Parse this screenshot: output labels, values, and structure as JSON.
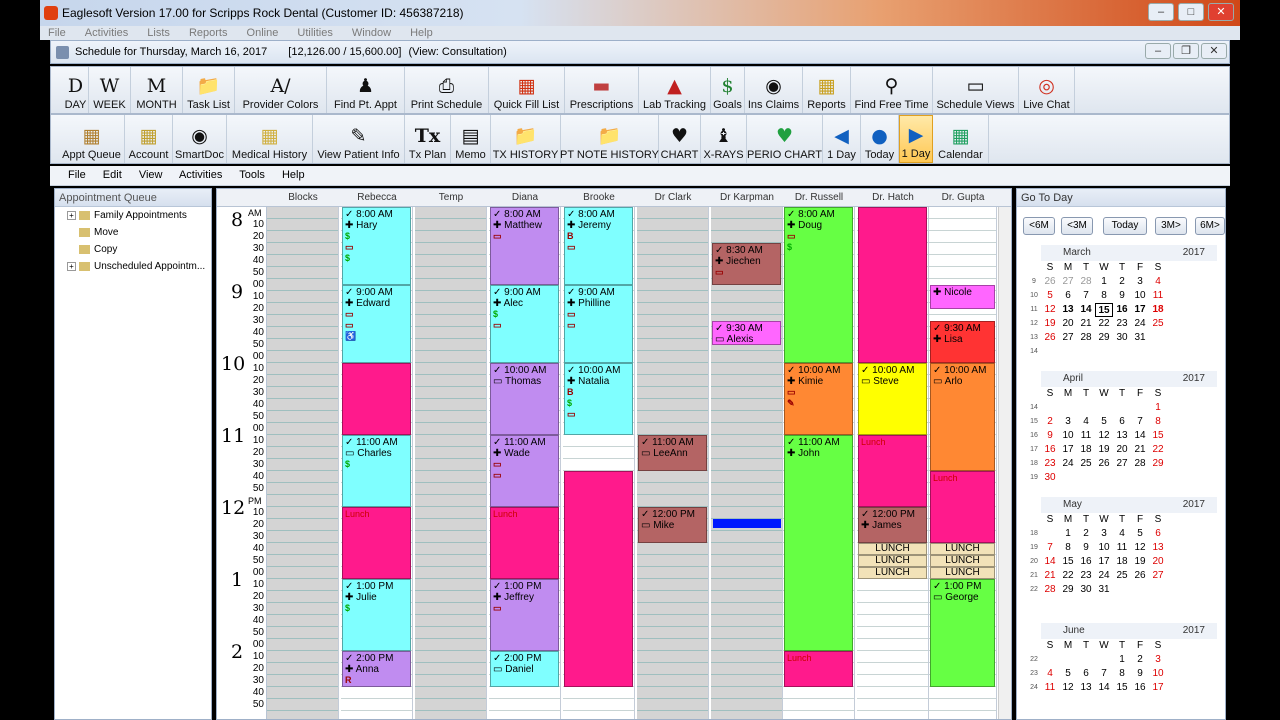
{
  "window": {
    "title": "Eaglesoft Version 17.00 for Scripps Rock Dental (Customer ID: 456387218)"
  },
  "outer_menu": [
    "File",
    "Activities",
    "Lists",
    "Reports",
    "Online",
    "Utilities",
    "Window",
    "Help"
  ],
  "schedule": {
    "title": "Schedule for Thursday, March 16, 2017",
    "totals": "[12,126.00 / 15,600.00]",
    "view": "(View: Consultation)"
  },
  "toolbar1": [
    "DAY",
    "WEEK",
    "MONTH",
    "Task List",
    "Provider Colors",
    "Find Pt. Appt",
    "Print Schedule",
    "Quick Fill List",
    "Prescriptions",
    "Lab Tracking",
    "Goals",
    "Ins Claims",
    "Reports",
    "Find Free Time",
    "Schedule Views",
    "Live Chat"
  ],
  "toolbar2": [
    "Appt Queue",
    "Account",
    "SmartDoc",
    "Medical History",
    "View Patient Info",
    "Tx Plan",
    "Memo",
    "TX HISTORY",
    "PT NOTE HISTORY",
    "CHART",
    "X-RAYS",
    "PERIO CHART",
    "1 Day",
    "Today",
    "1 Day",
    "Calendar"
  ],
  "inner_menu": [
    "File",
    "Edit",
    "View",
    "Activities",
    "Tools",
    "Help"
  ],
  "queue": {
    "title": "Appointment Queue",
    "items": [
      "Family Appointments",
      "Move",
      "Copy",
      "Unscheduled Appointm..."
    ]
  },
  "providers": [
    "Blocks",
    "Rebecca",
    "Temp",
    "Diana",
    "Brooke",
    "Dr Clark",
    "Dr Karpman",
    "Dr. Russell",
    "Dr. Hatch",
    "Dr. Gupta"
  ],
  "hours": [
    {
      "hour": "8",
      "ampm": "AM"
    },
    {
      "hour": "9",
      "ampm": ""
    },
    {
      "hour": "10",
      "ampm": ""
    },
    {
      "hour": "11",
      "ampm": ""
    },
    {
      "hour": "12",
      "ampm": "PM"
    },
    {
      "hour": "1",
      "ampm": ""
    },
    {
      "hour": "2",
      "ampm": ""
    }
  ],
  "minute_labels": [
    "00",
    "10",
    "20",
    "30",
    "40",
    "50"
  ],
  "appointments": [
    {
      "provider": 1,
      "start": 0,
      "slots": 13,
      "color": "cyan",
      "time": "8:00 AM",
      "name": "Hary",
      "icons": [
        "+",
        "$",
        "▭",
        "$"
      ]
    },
    {
      "provider": 1,
      "start": 13,
      "slots": 13,
      "color": "cyan",
      "time": "9:00 AM",
      "name": "Edward",
      "icons": [
        "+",
        "▭",
        "▭",
        "♿"
      ]
    },
    {
      "provider": 1,
      "start": 26,
      "slots": 12,
      "color": "pink",
      "time": "",
      "name": "",
      "icons": []
    },
    {
      "provider": 1,
      "start": 38,
      "slots": 12,
      "color": "cyan",
      "time": "11:00 AM",
      "name": "Charles",
      "icons": [
        "▭",
        "$"
      ]
    },
    {
      "provider": 1,
      "start": 50,
      "slots": 12,
      "color": "pink",
      "time": "",
      "name": "",
      "label": "Lunch",
      "icons": []
    },
    {
      "provider": 1,
      "start": 62,
      "slots": 12,
      "color": "cyan",
      "time": "1:00 PM",
      "name": "Julie",
      "icons": [
        "+",
        "$"
      ]
    },
    {
      "provider": 1,
      "start": 74,
      "slots": 6,
      "color": "lav",
      "time": "2:00 PM",
      "name": "Anna",
      "icons": [
        "+",
        "R",
        "▭"
      ]
    },
    {
      "provider": 3,
      "start": 0,
      "slots": 13,
      "color": "lav",
      "time": "8:00 AM",
      "name": "Matthew",
      "icons": [
        "+",
        "▭"
      ]
    },
    {
      "provider": 3,
      "start": 13,
      "slots": 13,
      "color": "cyan",
      "time": "9:00 AM",
      "name": "Alec",
      "icons": [
        "+",
        "$",
        "▭"
      ]
    },
    {
      "provider": 3,
      "start": 26,
      "slots": 12,
      "color": "lav",
      "time": "10:00 AM",
      "name": "Thomas",
      "icons": [
        "▭"
      ]
    },
    {
      "provider": 3,
      "start": 38,
      "slots": 12,
      "color": "lav",
      "time": "11:00 AM",
      "name": "Wade",
      "icons": [
        "+",
        "▭",
        "▭"
      ]
    },
    {
      "provider": 3,
      "start": 50,
      "slots": 12,
      "color": "pink",
      "time": "",
      "name": "",
      "label": "Lunch",
      "icons": []
    },
    {
      "provider": 3,
      "start": 62,
      "slots": 12,
      "color": "lav",
      "time": "1:00 PM",
      "name": "Jeffrey",
      "icons": [
        "+",
        "▭"
      ]
    },
    {
      "provider": 3,
      "start": 74,
      "slots": 6,
      "color": "cyan",
      "time": "2:00 PM",
      "name": "Daniel",
      "icons": [
        "▭"
      ]
    },
    {
      "provider": 4,
      "start": 0,
      "slots": 13,
      "color": "cyan",
      "time": "8:00 AM",
      "name": "Jeremy",
      "icons": [
        "+",
        "B",
        "▭"
      ]
    },
    {
      "provider": 4,
      "start": 13,
      "slots": 13,
      "color": "cyan",
      "time": "9:00 AM",
      "name": "Philline",
      "icons": [
        "+",
        "▭",
        "▭"
      ]
    },
    {
      "provider": 4,
      "start": 26,
      "slots": 12,
      "color": "cyan",
      "time": "10:00 AM",
      "name": "Natalia",
      "icons": [
        "+",
        "B",
        "$",
        "▭"
      ]
    },
    {
      "provider": 4,
      "start": 44,
      "slots": 36,
      "color": "pink",
      "time": "",
      "name": "",
      "icons": []
    },
    {
      "provider": 5,
      "start": 38,
      "slots": 6,
      "color": "brown",
      "time": "11:00 AM",
      "name": "LeeAnn",
      "icons": [
        "$"
      ]
    },
    {
      "provider": 5,
      "start": 50,
      "slots": 6,
      "color": "brown",
      "time": "12:00 PM",
      "name": "Mike",
      "icons": [
        "▭"
      ]
    },
    {
      "provider": 6,
      "start": 6,
      "slots": 7,
      "color": "brown",
      "time": "8:30 AM",
      "name": "Jiechen",
      "icons": [
        "+",
        "▭"
      ]
    },
    {
      "provider": 6,
      "start": 19,
      "slots": 4,
      "color": "magenta",
      "time": "9:30 AM",
      "name": "Alexis",
      "icons": [
        "▭"
      ]
    },
    {
      "provider": 7,
      "start": 0,
      "slots": 26,
      "color": "green",
      "time": "8:00 AM",
      "name": "Doug",
      "icons": [
        "+",
        "▭",
        "$"
      ]
    },
    {
      "provider": 7,
      "start": 26,
      "slots": 12,
      "color": "orange",
      "time": "10:00 AM",
      "name": "Kimie",
      "icons": [
        "+",
        "▭",
        "✎"
      ]
    },
    {
      "provider": 7,
      "start": 38,
      "slots": 36,
      "color": "green",
      "time": "11:00 AM",
      "name": "John",
      "icons": [
        "+"
      ]
    },
    {
      "provider": 7,
      "start": 74,
      "slots": 6,
      "color": "pink",
      "time": "",
      "name": "",
      "label": "Lunch",
      "icons": []
    },
    {
      "provider": 8,
      "start": 0,
      "slots": 26,
      "color": "pink",
      "time": "",
      "name": "",
      "icons": []
    },
    {
      "provider": 8,
      "start": 26,
      "slots": 12,
      "color": "yellow",
      "time": "10:00 AM",
      "name": "Steve",
      "icons": [
        "▭"
      ]
    },
    {
      "provider": 8,
      "start": 38,
      "slots": 12,
      "color": "pink",
      "time": "",
      "name": "",
      "label": "Lunch",
      "icons": []
    },
    {
      "provider": 8,
      "start": 50,
      "slots": 6,
      "color": "brown",
      "time": "12:00 PM",
      "name": "James",
      "icons": [
        "+"
      ]
    },
    {
      "provider": 9,
      "start": 13,
      "slots": 4,
      "color": "magenta",
      "time": "",
      "name": "Nicole",
      "icons": [
        "+"
      ]
    },
    {
      "provider": 9,
      "start": 19,
      "slots": 7,
      "color": "red",
      "time": "9:30 AM",
      "name": "Lisa",
      "icons": [
        "+"
      ]
    },
    {
      "provider": 9,
      "start": 26,
      "slots": 18,
      "color": "orange",
      "time": "10:00 AM",
      "name": "Arlo",
      "icons": [
        "▭"
      ]
    },
    {
      "provider": 9,
      "start": 44,
      "slots": 12,
      "color": "pink",
      "time": "",
      "name": "",
      "label": "Lunch",
      "icons": []
    },
    {
      "provider": 9,
      "start": 62,
      "slots": 18,
      "color": "green",
      "time": "1:00 PM",
      "name": "George",
      "icons": [
        "▭"
      ]
    }
  ],
  "lunch_labels": [
    {
      "provider": 8,
      "start": 56,
      "text": "LUNCH"
    },
    {
      "provider": 8,
      "start": 58,
      "text": "LUNCH"
    },
    {
      "provider": 8,
      "start": 60,
      "text": "LUNCH"
    },
    {
      "provider": 9,
      "start": 56,
      "text": "LUNCH"
    },
    {
      "provider": 9,
      "start": 58,
      "text": "LUNCH"
    },
    {
      "provider": 9,
      "start": 60,
      "text": "LUNCH"
    }
  ],
  "goto": {
    "title": "Go To Day",
    "buttons": [
      "<6M",
      "<3M",
      "Today",
      "3M>",
      "6M>"
    ],
    "weekdays": [
      "S",
      "M",
      "T",
      "W",
      "T",
      "F",
      "S"
    ],
    "months": [
      {
        "name": "March",
        "year": "2017",
        "weeks": [
          "9",
          "10",
          "11",
          "12",
          "13",
          "14"
        ],
        "days": [
          [
            "26",
            "27",
            "28",
            "1",
            "2",
            "3",
            "4"
          ],
          [
            "5",
            "6",
            "7",
            "8",
            "9",
            "10",
            "11"
          ],
          [
            "12",
            "13",
            "14",
            "15",
            "16",
            "17",
            "18"
          ],
          [
            "19",
            "20",
            "21",
            "22",
            "23",
            "24",
            "25"
          ],
          [
            "26",
            "27",
            "28",
            "29",
            "30",
            "31",
            ""
          ],
          [
            "",
            "",
            "",
            "",
            "",
            "",
            ""
          ]
        ]
      },
      {
        "name": "April",
        "year": "2017",
        "weeks": [
          "14",
          "15",
          "16",
          "17",
          "18",
          "19"
        ],
        "days": [
          [
            "",
            "",
            "",
            "",
            "",
            "",
            "1"
          ],
          [
            "2",
            "3",
            "4",
            "5",
            "6",
            "7",
            "8"
          ],
          [
            "9",
            "10",
            "11",
            "12",
            "13",
            "14",
            "15"
          ],
          [
            "16",
            "17",
            "18",
            "19",
            "20",
            "21",
            "22"
          ],
          [
            "23",
            "24",
            "25",
            "26",
            "27",
            "28",
            "29"
          ],
          [
            "30",
            "",
            "",
            "",
            "",
            "",
            ""
          ]
        ]
      },
      {
        "name": "May",
        "year": "2017",
        "weeks": [
          "18",
          "19",
          "20",
          "21",
          "22"
        ],
        "days": [
          [
            "",
            "1",
            "2",
            "3",
            "4",
            "5",
            "6"
          ],
          [
            "7",
            "8",
            "9",
            "10",
            "11",
            "12",
            "13"
          ],
          [
            "14",
            "15",
            "16",
            "17",
            "18",
            "19",
            "20"
          ],
          [
            "21",
            "22",
            "23",
            "24",
            "25",
            "26",
            "27"
          ],
          [
            "28",
            "29",
            "30",
            "31",
            "",
            "",
            ""
          ]
        ]
      },
      {
        "name": "June",
        "year": "2017",
        "weeks": [
          "22",
          "23",
          "24"
        ],
        "days": [
          [
            "",
            "",
            "",
            "",
            "1",
            "2",
            "3"
          ],
          [
            "4",
            "5",
            "6",
            "7",
            "8",
            "9",
            "10"
          ],
          [
            "11",
            "12",
            "13",
            "14",
            "15",
            "16",
            "17"
          ]
        ]
      }
    ]
  },
  "colors": {
    "cyan": "#7fffff",
    "lav": "#c08cf0",
    "pink": "#ff1a8c",
    "green": "#66ff44",
    "orange": "#ff8833",
    "yellow": "#ffff00",
    "brown": "#b46464",
    "magenta": "#ff66ff",
    "red": "#ff3333"
  }
}
